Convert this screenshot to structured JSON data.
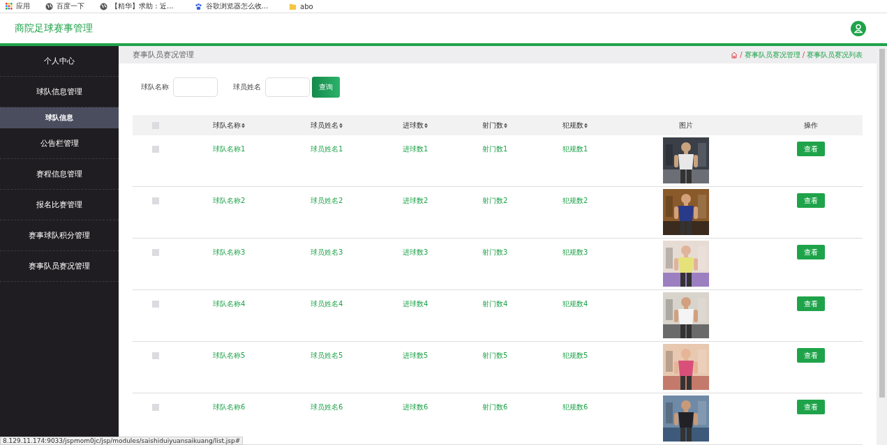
{
  "bookmarks": [
    {
      "kind": "apps",
      "label": "应用"
    },
    {
      "kind": "globe",
      "label": "百度一下"
    },
    {
      "kind": "globe",
      "label": "【精华】求助：近..."
    },
    {
      "kind": "paw",
      "label": "谷歌浏览器怎么收..."
    },
    {
      "kind": "folder",
      "label": "abo"
    }
  ],
  "header": {
    "title": "商院足球赛事管理"
  },
  "sidebar": {
    "items": [
      {
        "label": "个人中心"
      },
      {
        "label": "球队信息管理",
        "children": [
          {
            "label": "球队信息",
            "selected": true
          }
        ]
      },
      {
        "label": "公告栏管理"
      },
      {
        "label": "赛程信息管理"
      },
      {
        "label": "报名比赛管理"
      },
      {
        "label": "赛事球队积分管理"
      },
      {
        "label": "赛事队员赛况管理"
      }
    ]
  },
  "page_title": "赛事队员赛况管理",
  "breadcrumb": [
    {
      "separator": "/",
      "label": "赛事队员赛况管理"
    },
    {
      "separator": "/",
      "label": "赛事队员赛况列表"
    }
  ],
  "filters": [
    {
      "label": "球队名称"
    },
    {
      "label": "球员姓名"
    }
  ],
  "search_button": "查询",
  "table": {
    "select_all_checked": false,
    "columns": [
      {
        "label": "球队名称",
        "sortable": true
      },
      {
        "label": "球员姓名",
        "sortable": true
      },
      {
        "label": "进球数",
        "sortable": true
      },
      {
        "label": "射门数",
        "sortable": true
      },
      {
        "label": "犯规数",
        "sortable": true
      },
      {
        "label": "图片",
        "sortable": false
      },
      {
        "label": "操作",
        "sortable": false
      }
    ],
    "rows": [
      {
        "cells": [
          "球队名称1",
          "球员姓名1",
          "进球数1",
          "射门数1",
          "犯规数1"
        ],
        "action": "查看",
        "checked": false
      },
      {
        "cells": [
          "球队名称2",
          "球员姓名2",
          "进球数2",
          "射门数2",
          "犯规数2"
        ],
        "action": "查看",
        "checked": false
      },
      {
        "cells": [
          "球队名称3",
          "球员姓名3",
          "进球数3",
          "射门数3",
          "犯规数3"
        ],
        "action": "查看",
        "checked": false
      },
      {
        "cells": [
          "球队名称4",
          "球员姓名4",
          "进球数4",
          "射门数4",
          "犯规数4"
        ],
        "action": "查看",
        "checked": false
      },
      {
        "cells": [
          "球队名称5",
          "球员姓名5",
          "进球数5",
          "射门数5",
          "犯规数5"
        ],
        "action": "查看",
        "checked": false
      },
      {
        "cells": [
          "球队名称6",
          "球员姓名6",
          "进球数6",
          "射门数6",
          "犯规数6"
        ],
        "action": "查看",
        "checked": false
      }
    ]
  },
  "status_url": "8.129.11.174:9033/jspmom0jc/jsp/modules/saishiduiyuansaikuang/list.jsp#"
}
